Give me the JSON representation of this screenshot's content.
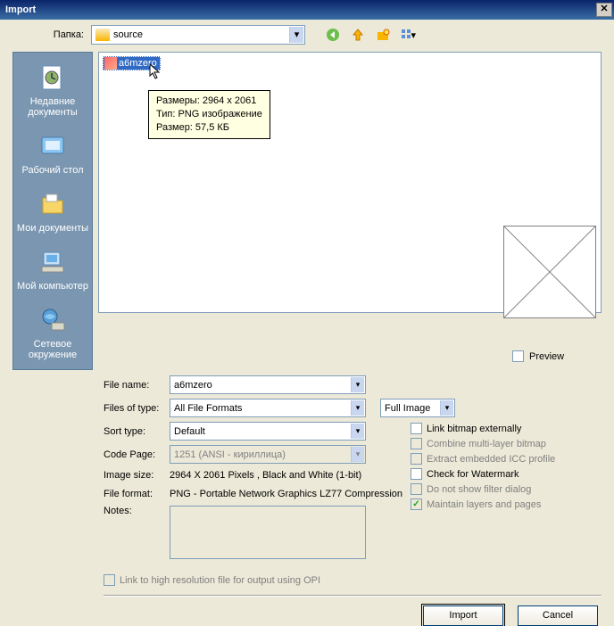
{
  "title": "Import",
  "folder_label": "Папка:",
  "folder_value": "source",
  "sidebar": [
    {
      "label": "Недавние документы"
    },
    {
      "label": "Рабочий стол"
    },
    {
      "label": "Мои документы"
    },
    {
      "label": "Мой компьютер"
    },
    {
      "label": "Сетевое окружение"
    }
  ],
  "file": {
    "name": "a6mzero"
  },
  "tooltip": {
    "line1": "Размеры: 2964 x 2061",
    "line2": "Тип: PNG изображение",
    "line3": "Размер: 57,5 КБ"
  },
  "form": {
    "filename_label": "File name:",
    "filename_value": "a6mzero",
    "filetype_label": "Files of type:",
    "filetype_value": "All File Formats",
    "fullimage_value": "Full Image",
    "sort_label": "Sort type:",
    "sort_value": "Default",
    "codepage_label": "Code Page:",
    "codepage_value": "1251 (ANSI - кириллица)",
    "imagesize_label": "Image size:",
    "imagesize_value": "2964 X 2061 Pixels , Black and White (1-bit)",
    "fileformat_label": "File format:",
    "fileformat_value": "PNG - Portable Network Graphics LZ77 Compression",
    "notes_label": "Notes:"
  },
  "checks": {
    "preview": "Preview",
    "link_ext": "Link bitmap externally",
    "combine": "Combine multi-layer bitmap",
    "extract": "Extract embedded ICC profile",
    "watermark": "Check for Watermark",
    "filter": "Do not show filter dialog",
    "maintain": "Maintain layers and pages",
    "opi": "Link to high resolution file for output using OPI"
  },
  "buttons": {
    "import": "Import",
    "cancel": "Cancel"
  }
}
